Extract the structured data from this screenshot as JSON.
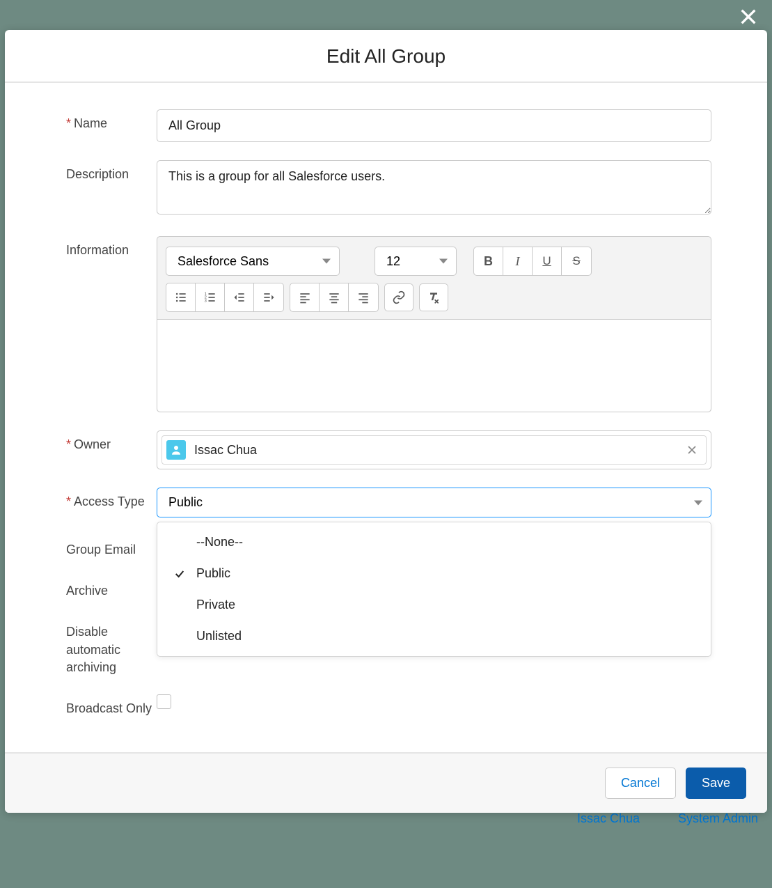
{
  "modal": {
    "title": "Edit All Group",
    "close_label": "Close"
  },
  "fields": {
    "name": {
      "label": "Name",
      "value": "All Group",
      "required": true
    },
    "description": {
      "label": "Description",
      "value": "This is a group for all Salesforce users."
    },
    "information": {
      "label": "Information"
    },
    "owner": {
      "label": "Owner",
      "value": "Issac Chua",
      "required": true
    },
    "access_type": {
      "label": "Access Type",
      "value": "Public",
      "required": true,
      "options": [
        "--None--",
        "Public",
        "Private",
        "Unlisted"
      ],
      "selected_index": 1
    },
    "group_email": {
      "label": "Group Email"
    },
    "archive": {
      "label": "Archive"
    },
    "disable_archive": {
      "label": "Disable automatic archiving"
    },
    "broadcast": {
      "label": "Broadcast Only"
    }
  },
  "editor": {
    "font": "Salesforce Sans",
    "size": "12"
  },
  "footer": {
    "cancel": "Cancel",
    "save": "Save"
  },
  "background": {
    "owner_link": "Issac Chua",
    "role_link": "System Admin"
  }
}
